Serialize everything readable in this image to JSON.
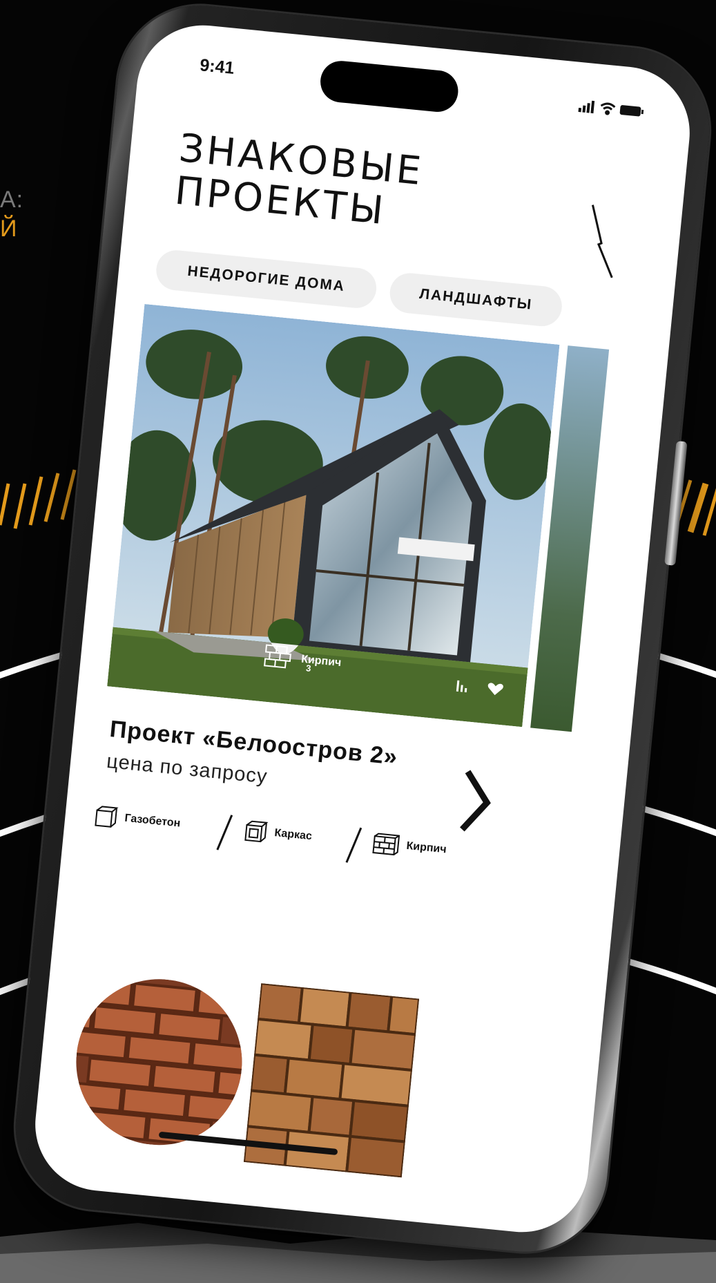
{
  "background": {
    "partial_heading": "А:",
    "partial_accent": "Й"
  },
  "status_bar": {
    "time": "9:41"
  },
  "header": {
    "title_line1": "ЗНАКОВЫЕ",
    "title_line2": "ПРОЕКТЫ"
  },
  "filters": [
    {
      "label": "НЕДОРОГИЕ ДОМА"
    },
    {
      "label": "ЛАНДШАФТЫ"
    }
  ],
  "card": {
    "photo_material": "Кирпич",
    "photo_material_count": "3",
    "name": "Проект «Белоостров 2»",
    "price": "цена по запросу",
    "materials": [
      {
        "icon": "block-icon",
        "label": "Газобетон"
      },
      {
        "icon": "frame-icon",
        "label": "Каркас"
      },
      {
        "icon": "brick-icon",
        "label": "Кирпич"
      }
    ]
  },
  "colors": {
    "accent": "#e39a1b",
    "screen_bg": "#ffffff",
    "chip_bg": "#efefef",
    "text": "#111111"
  }
}
